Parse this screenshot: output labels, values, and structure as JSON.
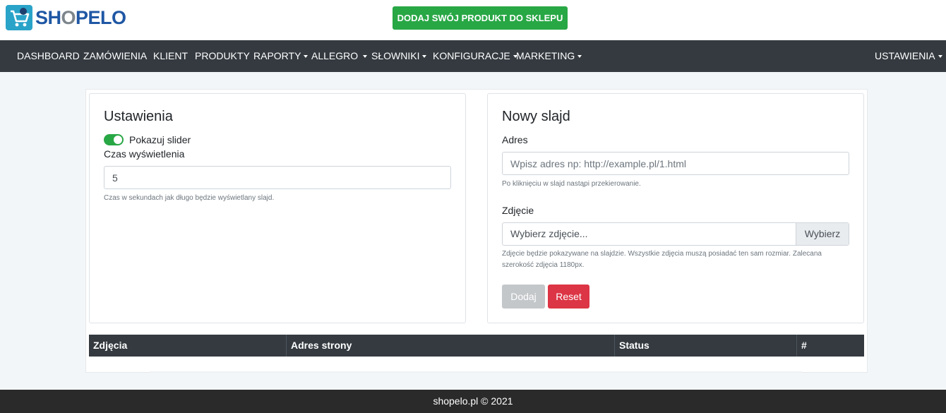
{
  "brand": {
    "name_part1": "SH",
    "name_o": "O",
    "name_part2": "PELO",
    "icon": "shopping-cart-icon",
    "color": "#1f57a4"
  },
  "header": {
    "add_product_label": "DODAJ SWÓJ PRODUKT DO SKLEPU"
  },
  "nav": {
    "items": [
      {
        "label": "DASHBOARD"
      },
      {
        "label": "ZAMÓWIENIA"
      },
      {
        "label": "KLIENT"
      },
      {
        "label": "PRODUKTY"
      },
      {
        "label": "RAPORTY"
      },
      {
        "label": "ALLEGRO"
      },
      {
        "label": "SŁOWNIKI"
      },
      {
        "label": "KONFIGURACJE"
      },
      {
        "label": "MARKETING"
      }
    ],
    "settings_label": "USTAWIENIA"
  },
  "settings_card": {
    "title": "Ustawienia",
    "slider_toggle_label": "Pokazuj slider",
    "display_time_label": "Czas wyświetlenia",
    "display_time_value": "5",
    "display_time_help": "Czas w sekundach jak długo będzie wyświetlany slajd."
  },
  "new_slide_card": {
    "title": "Nowy slajd",
    "address_label": "Adres",
    "address_placeholder": "Wpisz adres np: http://example.pl/1.html",
    "address_help": "Po kliknięciu w slajd nastąpi przekierowanie.",
    "image_label": "Zdjęcie",
    "image_placeholder": "Wybierz zdjęcie...",
    "browse_label": "Wybierz",
    "image_help_line1": "Zdjęcie będzie pokazywane na slajdzie. Wszystkie zdjęcia muszą posiadać ten sam rozmiar. Zalecana",
    "image_help_line2": "szerokość zdjęcia 1180px.",
    "add_label": "Dodaj",
    "reset_label": "Reset"
  },
  "table": {
    "columns": [
      "Zdjęcia",
      "Adres strony",
      "Status",
      "#"
    ]
  },
  "footer": {
    "text": "shopelo.pl © 2021"
  },
  "colors": {
    "accent_green": "#28a745",
    "danger_red": "#dc3545",
    "navbar_dark": "#343a40"
  }
}
